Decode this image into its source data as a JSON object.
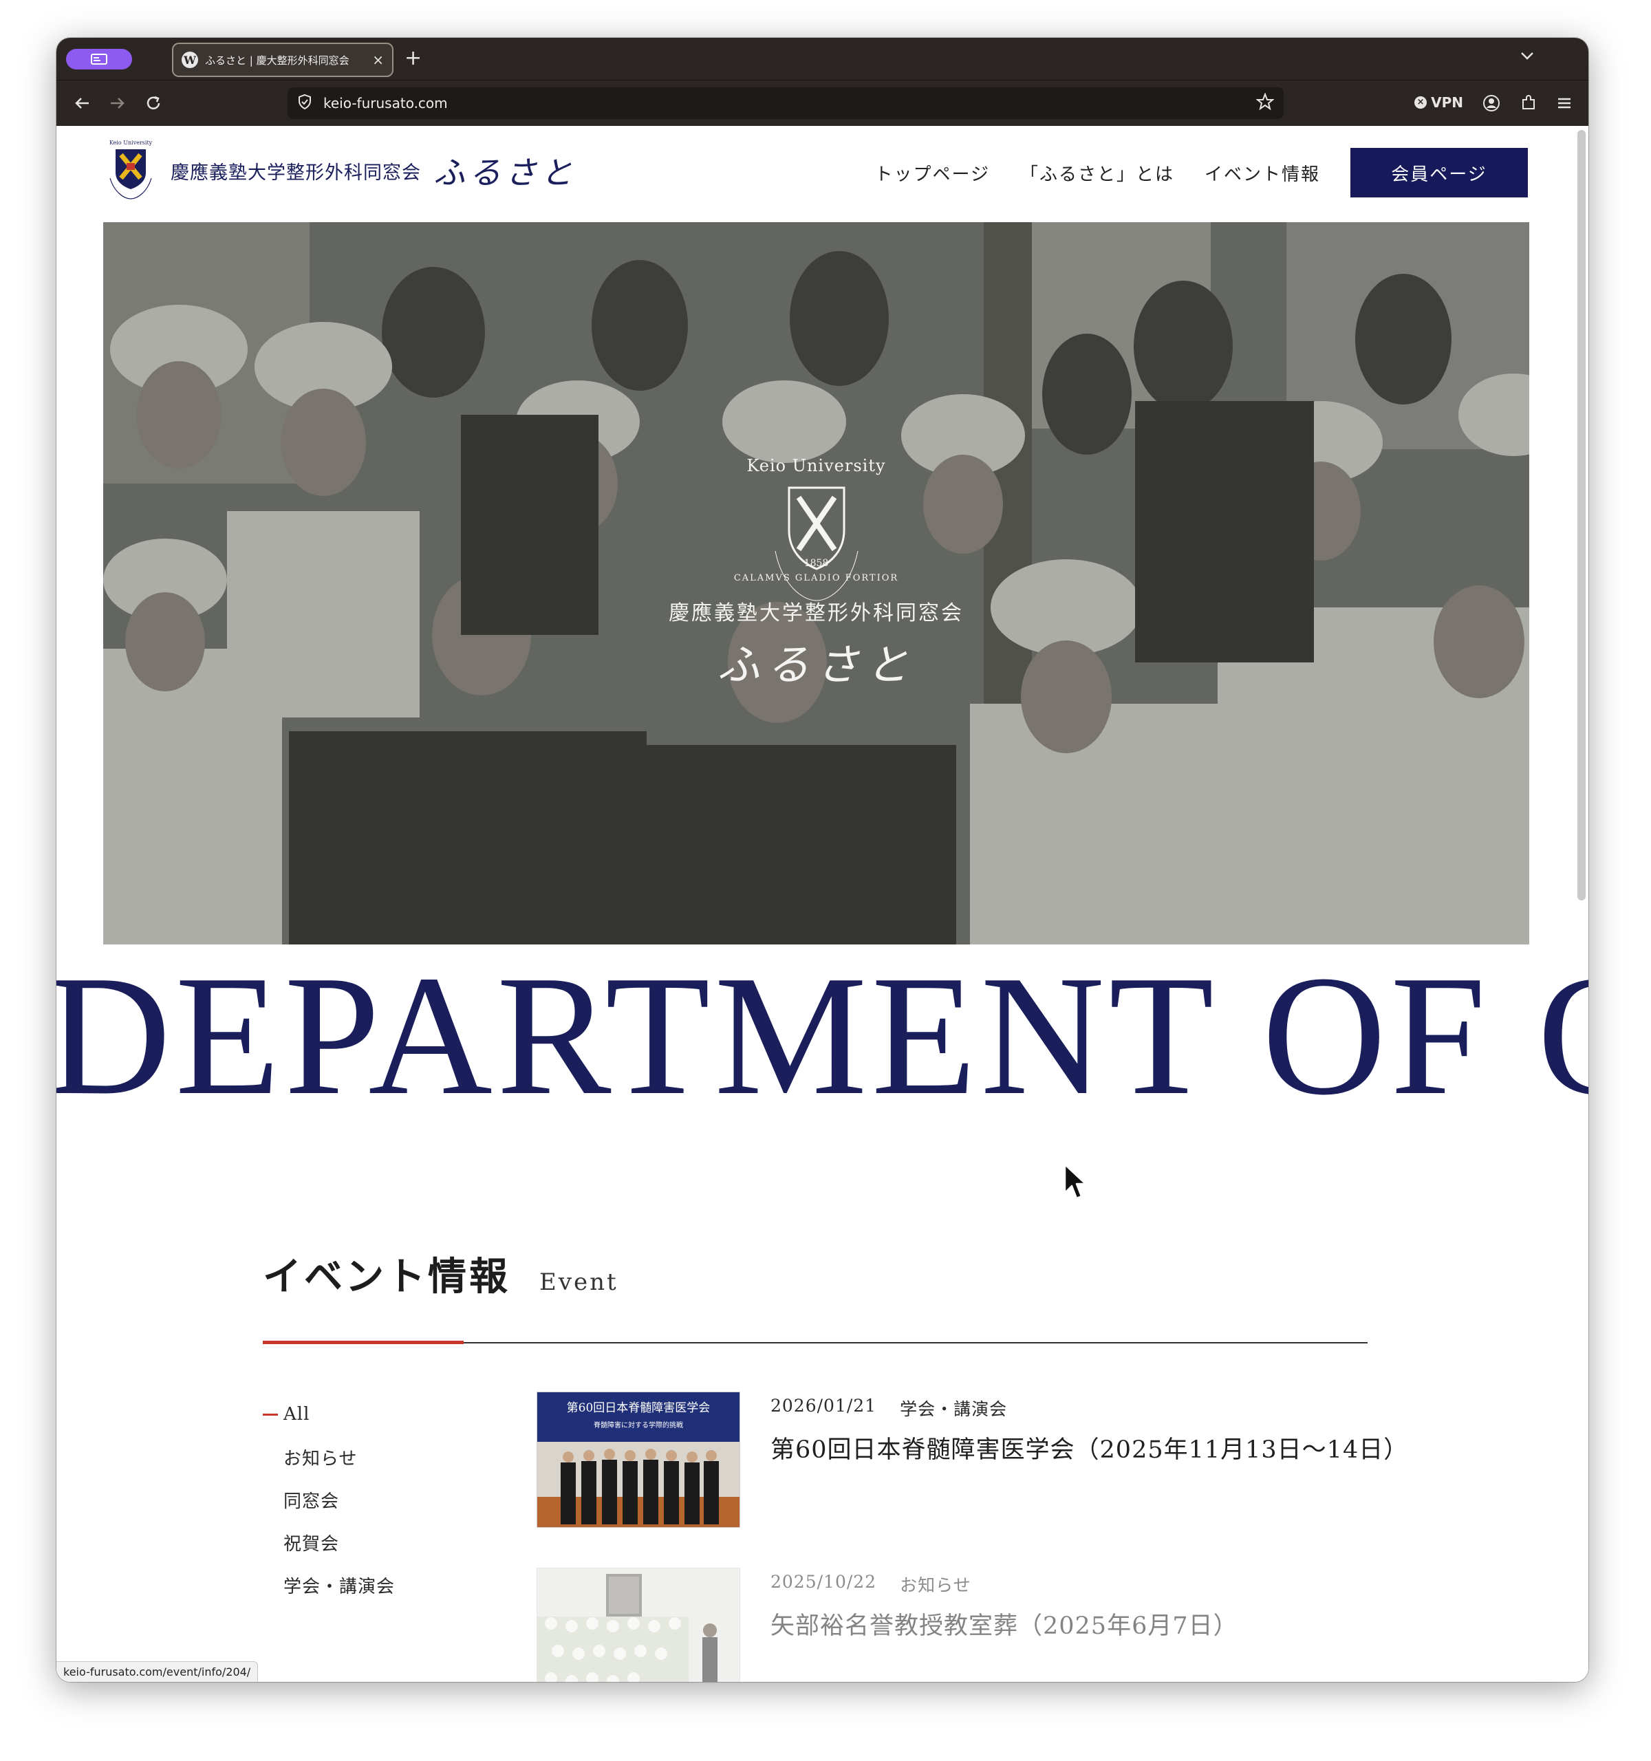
{
  "browser": {
    "tab_title": "ふるさと | 慶大整形外科同窓会",
    "new_tab_label": "+",
    "tab_close": "×",
    "url": "keio-furusato.com",
    "vpn_label": "VPN",
    "status_url": "keio-furusato.com/event/info/204/"
  },
  "header": {
    "logo_univ": "Keio University",
    "logo_jp": "慶應義塾大学整形外科同窓会",
    "logo_script": "ふるさと",
    "nav": [
      "トップページ",
      "「ふるさと」とは",
      "イベント情報"
    ],
    "member_button": "会員ページ"
  },
  "hero": {
    "univ": "Keio University",
    "year": "1858",
    "motto": "CALAMVS GLADIO FORTIOR",
    "jp": "慶應義塾大学整形外科同窓会",
    "script": "ふるさと"
  },
  "marquee_text": "DEPARTMENT OF O",
  "events": {
    "title": "イベント情報",
    "subtitle": "Event",
    "categories": [
      "All",
      "お知らせ",
      "同窓会",
      "祝賀会",
      "学会・講演会"
    ],
    "active_category": "All",
    "items": [
      {
        "date": "2026/01/21",
        "category": "学会・講演会",
        "title": "第60回日本脊髄障害医学会（2025年11月13日〜14日）",
        "thumb_banner": "第60回日本脊髄障害医学会",
        "thumb_sub": "脊髄障害に対する学際的挑戦"
      },
      {
        "date": "2025/10/22",
        "category": "お知らせ",
        "title": "矢部裕名誉教授教室葬（2025年6月7日）"
      }
    ]
  },
  "colors": {
    "navy": "#1a1f5c",
    "accent_red": "#c8372d",
    "browser_chrome": "#2b2623",
    "purple_pill": "#8d5bf0"
  },
  "icons": [
    "back-arrow-icon",
    "forward-arrow-icon",
    "reload-icon",
    "shield-icon",
    "star-icon",
    "account-icon",
    "extensions-icon",
    "menu-icon",
    "chevron-down-icon",
    "wordpress-icon",
    "mouse-cursor-icon"
  ]
}
